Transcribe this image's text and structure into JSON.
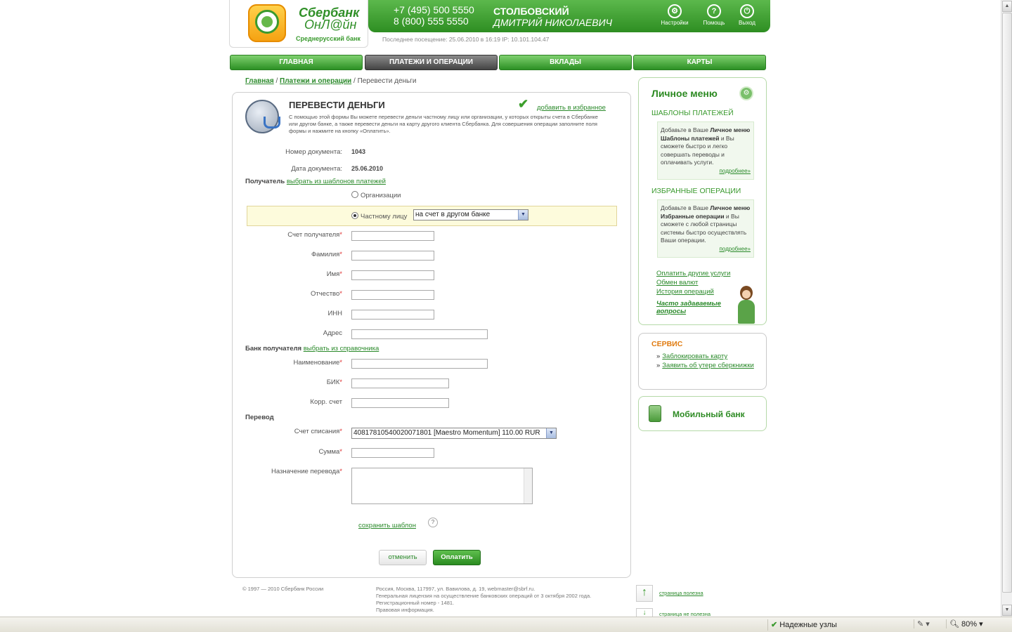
{
  "header": {
    "logo_title_1": "Сбербанк",
    "logo_title_2": "ОнЛ@йн",
    "logo_sub": "Среднерусский банк",
    "phone1": "+7 (495) 500 5550",
    "phone2": "8 (800) 555 5550",
    "user_last": "СТОЛБОВСКИЙ",
    "user_first": "ДМИТРИЙ НИКОЛАЕВИЧ",
    "settings": "Настройки",
    "help": "Помощь",
    "logout": "Выход",
    "last_visit": "Последнее посещение: 25.06.2010 в 16:19 IP: 10.101.104.47"
  },
  "nav": {
    "tabs": [
      {
        "label": "Главная"
      },
      {
        "label": "Платежи и операции"
      },
      {
        "label": "Вклады"
      },
      {
        "label": "Карты"
      }
    ]
  },
  "breadcrumb": {
    "home": "Главная",
    "payments": "Платежи и операции",
    "current": "Перевести деньги"
  },
  "form": {
    "title": "ПЕРЕВЕСТИ ДЕНЬГИ",
    "description": "С помощью этой формы Вы можете перевести деньги частному лицу или организации, у которых открыты счета в Сбербанке или другом банке, а также перевести деньги на карту другого клиента Сбербанка. Для совершения операции заполните поля формы и нажмите на кнопку «Оплатить».",
    "add_favorite": "добавить в избранное",
    "doc_number_label": "Номер документа:",
    "doc_number": "1043",
    "doc_date_label": "Дата документа:",
    "doc_date": "25.06.2010",
    "recipient_label": "Получатель",
    "recipient_link": "выбрать из шаблонов платежей",
    "radio_org": "Организации",
    "radio_private": "Частному лицу",
    "private_target": "на счет в другом банке",
    "account_label": "Счет получателя",
    "surname_label": "Фамилия",
    "name_label": "Имя",
    "patronymic_label": "Отчество",
    "inn_label": "ИНН",
    "address_label": "Адрес",
    "bank_label": "Банк получателя",
    "bank_link": "выбрать из справочника",
    "bank_name_label": "Наименование",
    "bik_label": "БИК",
    "corr_label": "Корр. счет",
    "transfer_label": "Перевод",
    "debit_label": "Счет списания",
    "debit_value": "40817810540020071801  [Maestro Momentum] 110.00  RUR",
    "amount_label": "Сумма",
    "purpose_label": "Назначение перевода",
    "required_mark": "*",
    "save_template": "сохранить шаблон",
    "help_mark": "?",
    "cancel": "отменить",
    "pay": "Оплатить"
  },
  "sidebar": {
    "title": "Личное меню",
    "templates_head": "ШАБЛОНЫ ПЛАТЕЖЕЙ",
    "templates_text_1": "Добавьте в Ваше ",
    "templates_bold": "Личное меню Шаблоны платежей",
    "templates_text_2": " и Вы сможете быстро и легко совершать переводы и оплачивать услуги.",
    "more": "подробнее»",
    "favorites_head": "ИЗБРАННЫЕ ОПЕРАЦИИ",
    "favorites_text_1": "Добавьте в Ваше ",
    "favorites_bold": "Личное меню Избранные операции",
    "favorites_text_2": " и Вы сможете с любой страницы системы быстро осуществлять Ваши операции.",
    "link_other": "Оплатить другие услуги",
    "link_exchange": "Обмен валют",
    "link_history": "История операций",
    "link_faq": "Часто задаваемые вопросы",
    "service_title": "СЕРВИС",
    "service_bullet": "»",
    "service_block": "Заблокировать карту",
    "service_lost": "Заявить об утере сберкнижки",
    "mobile": "Мобильный банк"
  },
  "footer": {
    "copyright": "© 1997 — 2010 Сбербанк России",
    "address": "Россия, Москва, 117997, ул. Вавилова, д. 19, webmaster@sbrf.ru.",
    "license": "Генеральная лицензия на осуществление банковских операций от 3 октября 2002 года.",
    "reg": "Регистрационный номер - 1481.",
    "legal": "Правовая информация.",
    "helpful": "страница полезна",
    "unhelpful": "страница не полезна"
  },
  "statusbar": {
    "trusted": "Надежные узлы",
    "zoom": "80%"
  }
}
